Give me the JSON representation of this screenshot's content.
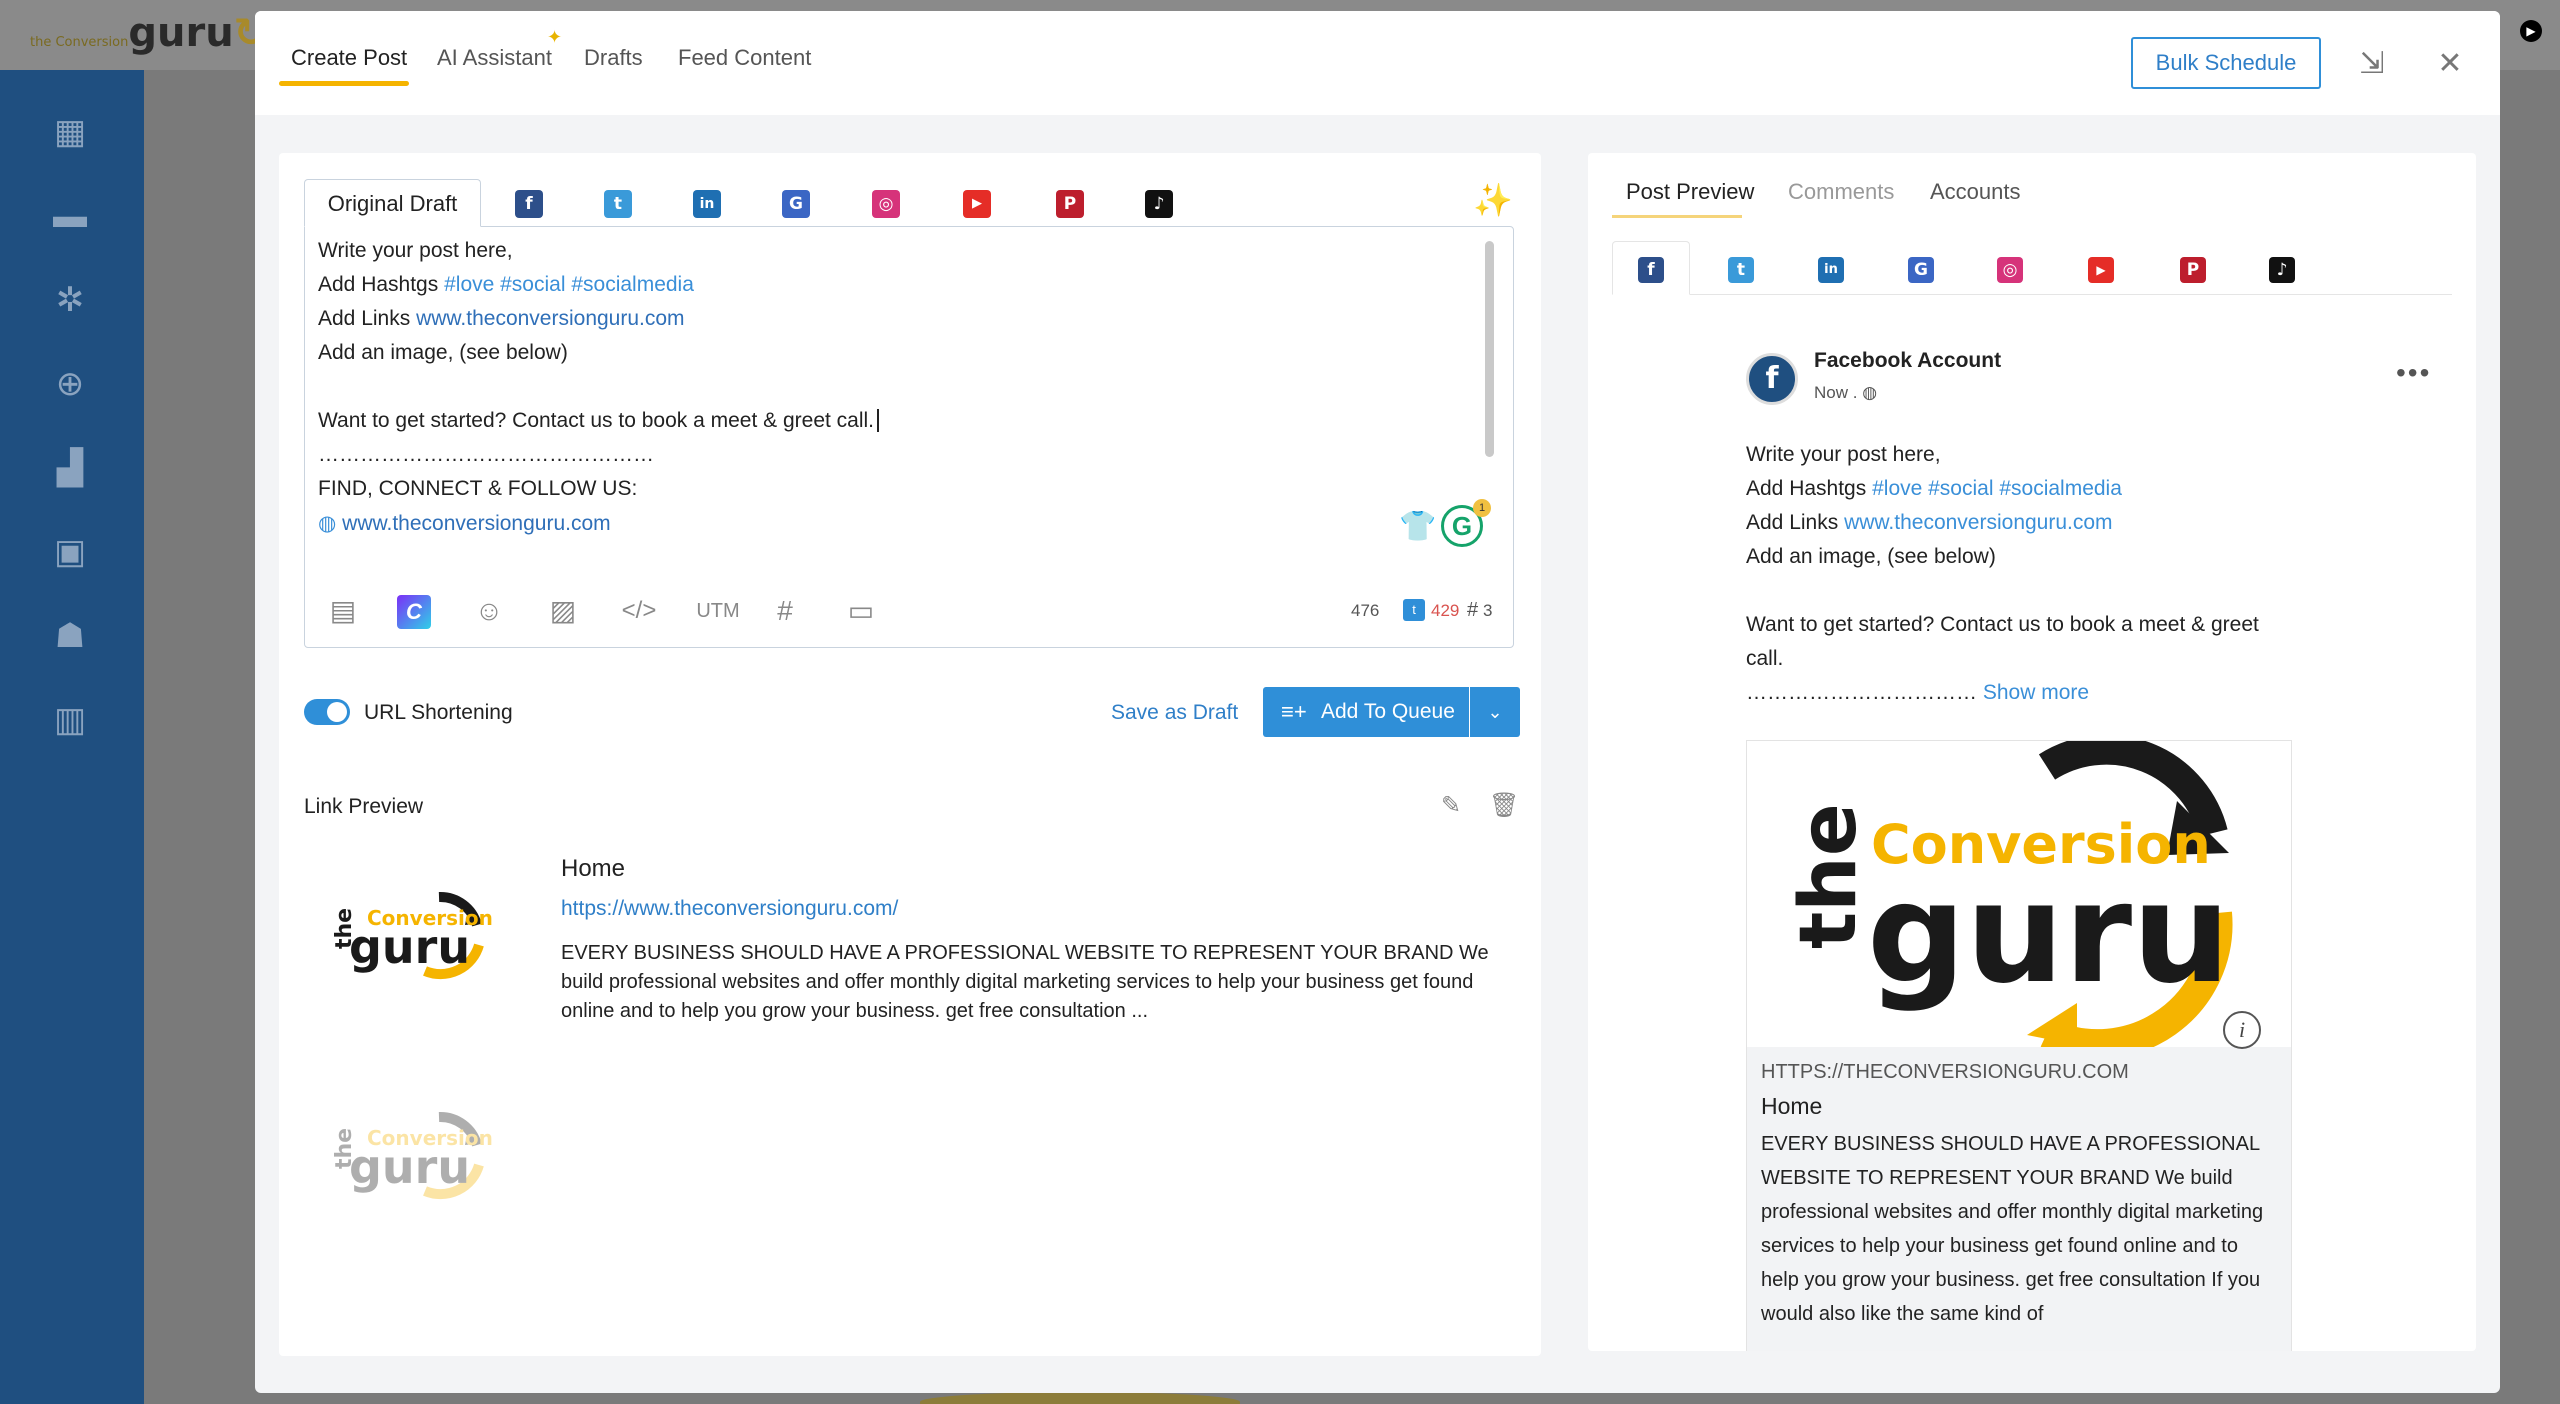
{
  "app": {
    "logo_small": "the Conversion",
    "logo_big": "guru"
  },
  "header": {
    "tabs": [
      "Create Post",
      "AI Assistant",
      "Drafts",
      "Feed Content"
    ],
    "bulk_schedule": "Bulk Schedule",
    "icons": [
      "minimize-icon",
      "close-icon"
    ]
  },
  "sidebar": {
    "icons": [
      "dashboard-icon",
      "chat-icon",
      "network-icon",
      "target-icon",
      "analytics-icon",
      "inbox-icon",
      "team-icon",
      "library-icon"
    ]
  },
  "editor": {
    "original_draft_tab": "Original Draft",
    "networks": [
      {
        "name": "facebook-icon",
        "glyph": "f",
        "color": "#2d4f8a"
      },
      {
        "name": "twitter-icon",
        "glyph": "t",
        "color": "#3a9ad9"
      },
      {
        "name": "linkedin-icon",
        "glyph": "in",
        "color": "#1f6fb2"
      },
      {
        "name": "google-business-icon",
        "glyph": "G",
        "color": "#3b66c4"
      },
      {
        "name": "instagram-icon",
        "glyph": "◎",
        "color": "#d6337a"
      },
      {
        "name": "youtube-icon",
        "glyph": "▶",
        "color": "#e52d27"
      },
      {
        "name": "pinterest-icon",
        "glyph": "P",
        "color": "#bd1e2d"
      },
      {
        "name": "tiktok-icon",
        "glyph": "♪",
        "color": "#111111"
      }
    ],
    "line1": "Write your post here,",
    "line2_prefix": "Add Hashtgs",
    "line2_tags": "#love #social #socialmedia",
    "line3_prefix": "Add Links",
    "line3_link": "www.theconversionguru.com",
    "line4": "Add an image, (see below)",
    "line5": "Want to get started?  Contact us to book a meet & greet call.",
    "line6": "…………………………………………",
    "line7": "FIND, CONNECT & FOLLOW US:",
    "line8_link": "www.theconversionguru.com",
    "grammarly_badge": "1",
    "toolbar": {
      "utm": "UTM",
      "count_total": "476",
      "count_twitter": "429",
      "count_hashtags": "3"
    }
  },
  "actions": {
    "url_shortening": "URL Shortening",
    "url_shortening_on": true,
    "save_as_draft": "Save as Draft",
    "add_to_queue": "Add To Queue"
  },
  "link_preview": {
    "title": "Link Preview",
    "home": "Home",
    "url": "https://www.theconversionguru.com/",
    "description": "EVERY BUSINESS SHOULD HAVE A PROFESSIONAL WEBSITE TO REPRESENT YOUR BRAND We build professional websites and offer monthly digital marketing services to help your business get found online and to help you grow your business. get free consultation ..."
  },
  "post_preview": {
    "tabs": [
      "Post Preview",
      "Comments",
      "Accounts"
    ],
    "account_name": "Facebook Account",
    "time": "Now .",
    "line1": "Write your post here,",
    "line2_prefix": "Add Hashtgs",
    "line2_tags": "#love #social #socialmedia",
    "line3_prefix": "Add Links",
    "line3_link": "www.theconversionguru.com",
    "line4": "Add an image, (see below)",
    "line5a": "Want to get started? Contact us to book a meet & greet",
    "line5b": "call.",
    "dots": "……………………………",
    "show_more": "Show more",
    "card": {
      "domain": "HTTPS://THECONVERSIONGURU.COM",
      "home": "Home",
      "description": "EVERY BUSINESS SHOULD HAVE A PROFESSIONAL WEBSITE TO REPRESENT YOUR BRAND We build professional websites and offer monthly digital marketing services to help your business get found online and to help you grow your business. get free consultation If you would also like the same kind of"
    }
  },
  "brand": {
    "logo_the": "the",
    "logo_conversion": "Conversion",
    "logo_guru": "guru",
    "accent": "#2f8fd8",
    "yellow": "#f5b400"
  }
}
